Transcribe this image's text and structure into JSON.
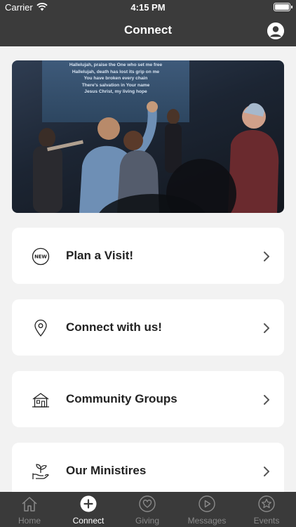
{
  "status_bar": {
    "carrier": "Carrier",
    "time": "4:15 PM"
  },
  "header": {
    "title": "Connect"
  },
  "hero": {
    "lyrics": [
      "Hallelujah, praise the One who set me free",
      "Hallelujah, death has lost its grip on me",
      "You have broken every chain",
      "There's salvation in Your name",
      "Jesus Christ, my living hope"
    ]
  },
  "cards": [
    {
      "label": "Plan a Visit!",
      "icon": "new-badge-icon"
    },
    {
      "label": "Connect with us!",
      "icon": "location-pin-icon"
    },
    {
      "label": "Community Groups",
      "icon": "house-icon"
    },
    {
      "label": "Our Ministires",
      "icon": "hand-plant-icon"
    }
  ],
  "tabs": [
    {
      "label": "Home",
      "icon": "home-icon"
    },
    {
      "label": "Connect",
      "icon": "plus-circle-icon"
    },
    {
      "label": "Giving",
      "icon": "heart-circle-icon"
    },
    {
      "label": "Messages",
      "icon": "play-circle-icon"
    },
    {
      "label": "Events",
      "icon": "star-circle-icon"
    }
  ],
  "active_tab": "Connect",
  "colors": {
    "nav_bg": "#3b3b3b",
    "tab_bg": "#3a3a3a",
    "page_bg": "#f2f2f2",
    "card_bg": "#ffffff",
    "active_tab": "#ffffff",
    "inactive_tab": "#8a8a8a"
  }
}
